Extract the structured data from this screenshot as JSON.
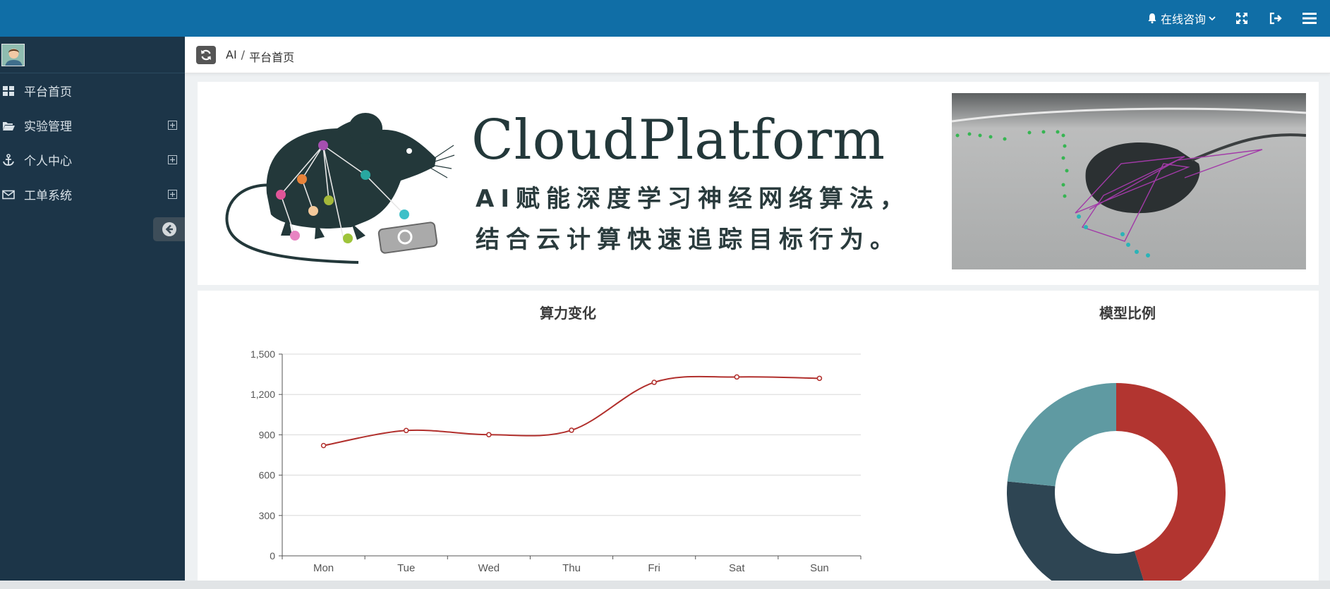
{
  "header": {
    "consult_label": "在线咨询",
    "icons": [
      "bell-icon",
      "chevron-down-icon",
      "fullscreen-icon",
      "logout-icon",
      "menu-icon"
    ]
  },
  "sidebar": {
    "items": [
      {
        "label": "平台首页",
        "icon": "dashboard-icon",
        "expandable": false
      },
      {
        "label": "实验管理",
        "icon": "folder-open-icon",
        "expandable": true
      },
      {
        "label": "个人中心",
        "icon": "anchor-icon",
        "expandable": true
      },
      {
        "label": "工单系统",
        "icon": "envelope-icon",
        "expandable": true
      }
    ]
  },
  "breadcrumb": {
    "root": "AI",
    "separator": "/",
    "current": "平台首页"
  },
  "banner": {
    "title": "CloudPlatform",
    "slogan_line1": "AI赋能深度学习神经网络算法，",
    "slogan_line2": "结合云计算快速追踪目标行为。"
  },
  "charts": {
    "line_title": "算力变化",
    "pie_title": "模型比例"
  },
  "chart_data": [
    {
      "type": "line",
      "title": "算力变化",
      "categories": [
        "Mon",
        "Tue",
        "Wed",
        "Thu",
        "Fri",
        "Sat",
        "Sun"
      ],
      "series": [
        {
          "values": [
            820,
            932,
            901,
            934,
            1290,
            1330,
            1320
          ]
        }
      ],
      "ylim": [
        0,
        1500
      ],
      "yticks": [
        "0",
        "300",
        "600",
        "900",
        "1,200",
        "1,500"
      ],
      "grid": true,
      "color": "#b12f2c",
      "smooth": true
    },
    {
      "type": "pie",
      "title": "模型比例",
      "donut": true,
      "slices": [
        {
          "value": 0.452,
          "color": "#b23530"
        },
        {
          "value": 0.314,
          "color": "#2e4553"
        },
        {
          "value": 0.234,
          "color": "#5f9aa2"
        }
      ]
    }
  ],
  "colors": {
    "topbar": "#106ea6",
    "sidebar": "#1c3548",
    "accent_red": "#b12f2c"
  }
}
